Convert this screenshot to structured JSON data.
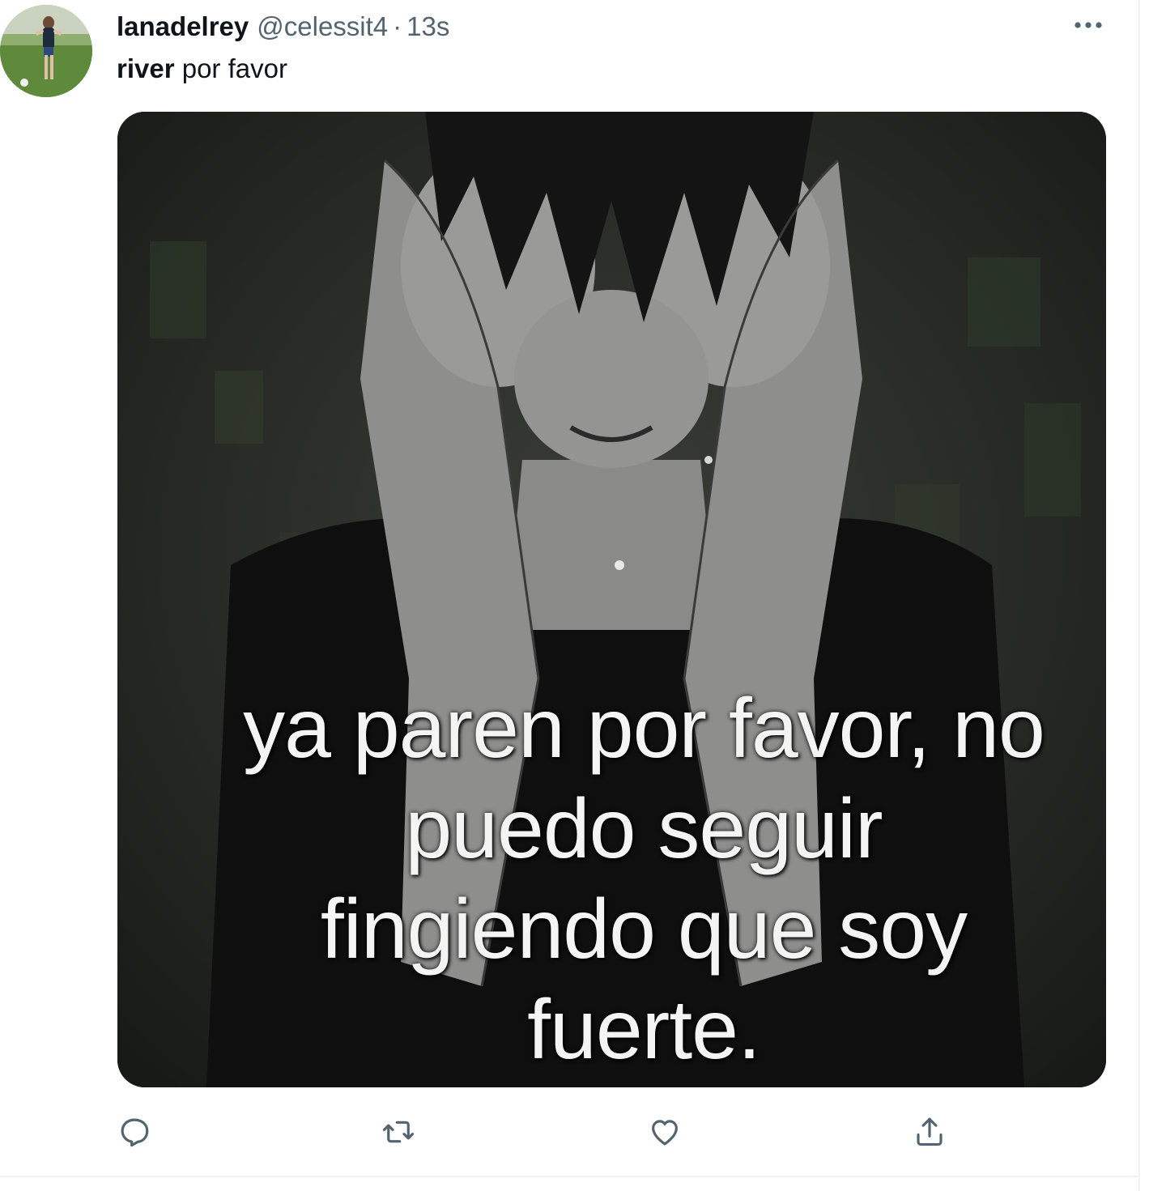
{
  "tweet": {
    "display_name": "lanadelrey",
    "handle": "@celessit4",
    "separator": "·",
    "timestamp": "13s",
    "text_bold": "river",
    "text_rest": " por favor",
    "more_icon": "more-horizontal-icon"
  },
  "media": {
    "caption_lines": [
      "ya paren por favor, no",
      "puedo seguir",
      "fingiendo que soy",
      "fuerte."
    ]
  },
  "actions": {
    "reply_icon": "reply-icon",
    "retweet_icon": "retweet-icon",
    "like_icon": "heart-icon",
    "share_icon": "share-icon"
  },
  "colors": {
    "text_primary": "#0f1419",
    "text_secondary": "#536471",
    "border": "#eff3f4"
  }
}
